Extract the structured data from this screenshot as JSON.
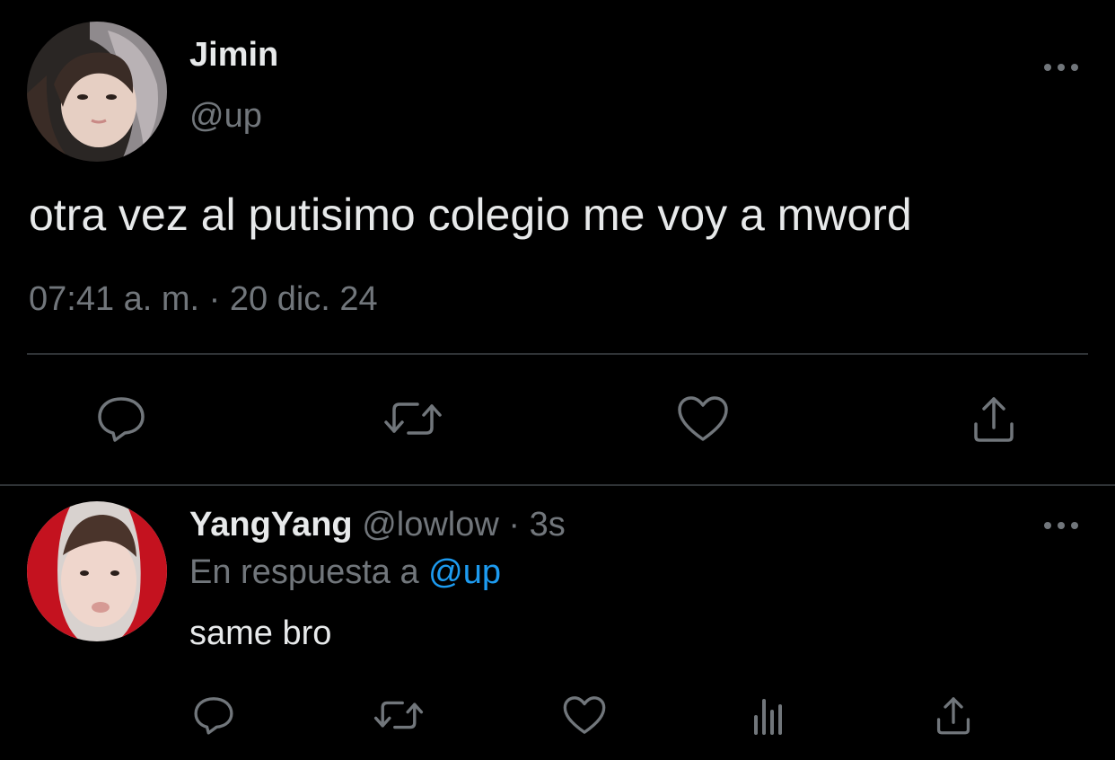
{
  "tweet": {
    "author_name": "Jimin",
    "author_handle": "@up",
    "text": "otra vez al putisimo colegio me voy a mword",
    "timestamp": "07:41 a. m. · 20 dic. 24",
    "more_icon": "more-horizontal-icon",
    "actions": [
      "reply-icon",
      "retweet-icon",
      "like-icon",
      "share-icon"
    ]
  },
  "reply": {
    "author_name": "YangYang",
    "author_handle": "@lowlow",
    "separator": "·",
    "time": "3s",
    "in_reply_prefix": "En respuesta a",
    "in_reply_mention": "@up",
    "text": "same bro",
    "more_icon": "more-horizontal-icon",
    "actions": [
      "reply-icon",
      "retweet-icon",
      "like-icon",
      "analytics-icon",
      "share-icon"
    ]
  },
  "colors": {
    "background": "#000000",
    "primary_text": "#e7e9ea",
    "secondary_text": "#71767b",
    "accent": "#1d9bf0",
    "divider": "#2f3336"
  }
}
